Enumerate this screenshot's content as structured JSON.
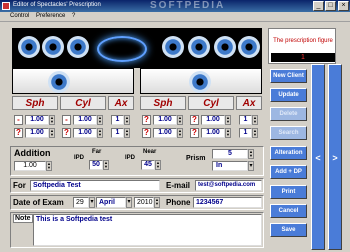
{
  "window": {
    "title": "Editor of Spectacles' Prescription",
    "watermark": "SOFTPEDIA",
    "minimize": "_",
    "maximize": "□",
    "close": "×"
  },
  "menu": [
    "Control",
    "Preference",
    "?"
  ],
  "figure": {
    "title": "The prescription figure",
    "number": "1"
  },
  "headers": {
    "sph": "Sph",
    "cyl": "Cyl",
    "ax": "Ax"
  },
  "signs": {
    "minus": "-",
    "question": "?"
  },
  "left_eye": {
    "row1": {
      "sph": "1.00",
      "cyl": "1.00",
      "ax": "1"
    },
    "row2": {
      "sph": "1.00",
      "cyl": "1.00",
      "ax": "1"
    }
  },
  "right_eye": {
    "row1": {
      "sph": "1.00",
      "cyl": "1.00",
      "ax": "1"
    },
    "row2": {
      "sph": "1.00",
      "cyl": "1.00",
      "ax": "1"
    }
  },
  "addition": {
    "label": "Addition",
    "value": "1.00"
  },
  "ipd": {
    "label": "IPD",
    "far_label": "Far",
    "far_value": "50",
    "label2": "IPD",
    "near_label": "Near",
    "near_value": "45"
  },
  "prism": {
    "label": "Prism",
    "value": "5",
    "direction": "In"
  },
  "client": {
    "for_label": "For",
    "name": "Softpedia Test",
    "email_label": "E-mail",
    "email": "test@softpedia.com",
    "date_label": "Date of Exam",
    "day": "29",
    "month": "April",
    "year": "2010",
    "phone_label": "Phone",
    "phone": "1234567",
    "note_label": "Note",
    "note": "This is a Softpedia test"
  },
  "buttons": {
    "new_client": "New Client",
    "update": "Update",
    "delete": "Delete",
    "search": "Search",
    "alteration": "Alteration",
    "add_dp": "Add + DP",
    "print": "Print",
    "cancel": "Cancel",
    "save": "Save"
  },
  "nav": {
    "prev": "<",
    "next": ">"
  },
  "colors": {
    "accent_blue": "#4a7cd8",
    "header_red": "#a00000",
    "value_blue": "#00008b"
  }
}
